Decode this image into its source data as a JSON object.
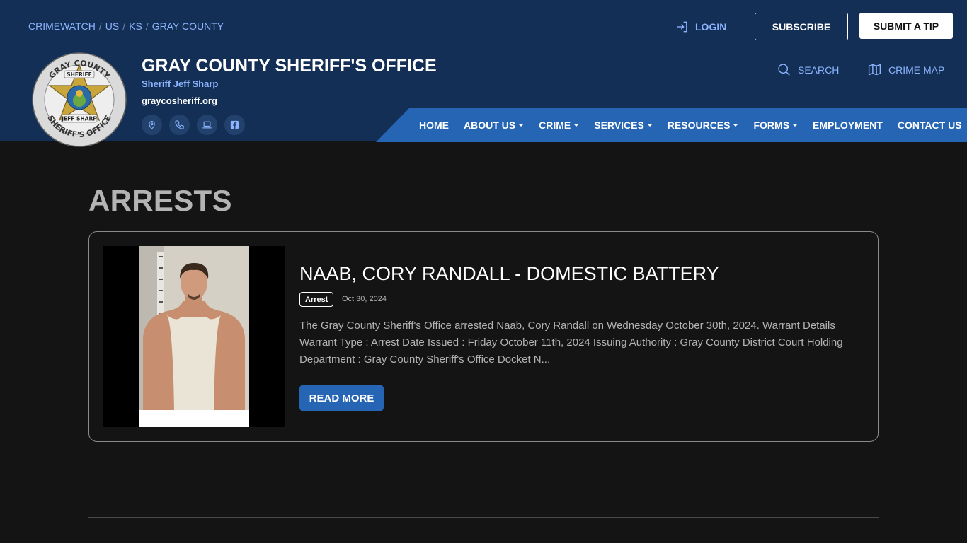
{
  "breadcrumb": [
    "CRIMEWATCH",
    "US",
    "KS",
    "GRAY COUNTY"
  ],
  "breadcrumb_sep": "/",
  "header": {
    "login_label": "LOGIN",
    "subscribe_label": "SUBSCRIBE",
    "tip_label": "SUBMIT A TIP",
    "title": "GRAY COUNTY SHERIFF'S OFFICE",
    "subtitle": "Sheriff Jeff Sharp",
    "url": "graycosheriff.org",
    "search_label": "SEARCH",
    "crime_map_label": "CRIME MAP",
    "social_icons": [
      "location-icon",
      "phone-icon",
      "laptop-icon",
      "facebook-icon"
    ]
  },
  "seal": {
    "top_text": "GRAY COUNTY",
    "bottom_text": "SHERIFF'S OFFICE",
    "badge_top": "SHERIFF",
    "badge_bottom": "JEFF SHARP"
  },
  "nav": [
    {
      "label": "HOME",
      "dropdown": false
    },
    {
      "label": "ABOUT US",
      "dropdown": true
    },
    {
      "label": "CRIME",
      "dropdown": true
    },
    {
      "label": "SERVICES",
      "dropdown": true
    },
    {
      "label": "RESOURCES",
      "dropdown": true
    },
    {
      "label": "FORMS",
      "dropdown": true
    },
    {
      "label": "EMPLOYMENT",
      "dropdown": false
    },
    {
      "label": "CONTACT US",
      "dropdown": false
    }
  ],
  "page": {
    "title": "ARRESTS"
  },
  "post": {
    "title": "NAAB, CORY RANDALL - DOMESTIC BATTERY",
    "badge": "Arrest",
    "date": "Oct 30, 2024",
    "excerpt": "The Gray County Sheriff's Office arrested Naab, Cory Randall on Wednesday October 30th, 2024. Warrant Details Warrant Type : Arrest Date Issued : Friday October 11th, 2024 Issuing Authority : Gray County District Court Holding Department : Gray County Sheriff's Office Docket N...",
    "read_more_label": "READ MORE"
  },
  "colors": {
    "header_bg": "#142f55",
    "accent": "#2565b4",
    "link": "#8cb4ff",
    "page_bg": "#141414"
  }
}
